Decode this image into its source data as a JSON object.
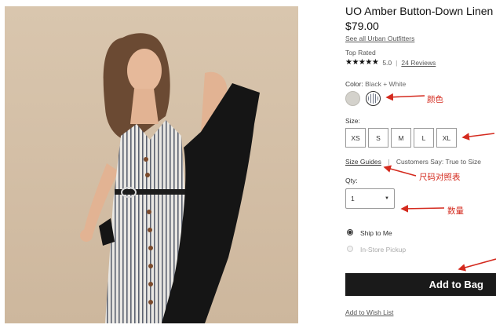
{
  "product": {
    "title": "UO Amber Button-Down Linen",
    "price": "$79.00",
    "see_all": "See all Urban Outfitters",
    "rating_heading": "Top Rated",
    "stars_glyph": "★★★★★",
    "rating_value": "5.0",
    "rating_sep": "|",
    "reviews_link": "24 Reviews"
  },
  "color": {
    "label": "Color:",
    "selected": "Black + White"
  },
  "size": {
    "label": "Size:",
    "options": [
      "XS",
      "S",
      "M",
      "L",
      "XL"
    ],
    "guides_link": "Size Guides",
    "sep": "|",
    "customers_say": "Customers Say: True to Size"
  },
  "qty": {
    "label": "Qty:",
    "value": "1",
    "caret": "▼"
  },
  "fulfillment": {
    "ship_to_me": "Ship to Me",
    "in_store_pickup": "In-Store Pickup",
    "selected": "ship"
  },
  "actions": {
    "add_to_bag": "Add to Bag",
    "wish_list": "Add to Wish List"
  },
  "annotations": {
    "color": "颜色",
    "size_chart": "尺码对照表",
    "quantity": "数量",
    "accent": "#d42a1e"
  }
}
